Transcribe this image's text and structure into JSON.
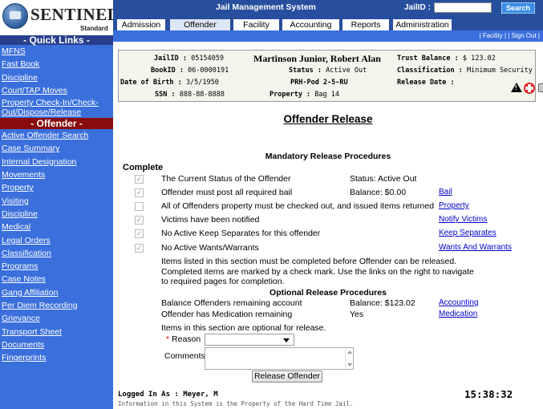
{
  "logo": {
    "brand": "SENTINEL",
    "sub": "Standard"
  },
  "header": {
    "title": "Jail Management System",
    "jailid_label": "JailID :",
    "search_label": "Search",
    "tabs": [
      "Admission",
      "Offender",
      "Facility",
      "Accounting",
      "Reports",
      "Administration"
    ],
    "links": [
      "| Facility |",
      "| Sign Out |"
    ]
  },
  "sidebar": {
    "quick_links_title": "- Quick Links -",
    "quick_links": [
      "MFNS",
      "Fast Book",
      "Discipline",
      "Court/TAP Moves",
      "Property Check-In/Check-Out/Dispose/Release"
    ],
    "offender_title": "- Offender -",
    "offender_links": [
      "Active Offender Search",
      "Case Summary",
      "Internal Designation",
      "Movements",
      "Property",
      "Visiting",
      "Discipline",
      "Medical",
      "Legal Orders",
      "Classification",
      "Programs",
      "Case Notes",
      "Gang Affiliation",
      "Per Diem Recording",
      "Grievance",
      "Transport Sheet",
      "Documents",
      "Fingerprints"
    ]
  },
  "offender": {
    "jailid_label": "JailID :",
    "jailid": "05154059",
    "bookid_label": "BookID :",
    "bookid": "06-0000191",
    "dob_label": "Date of Birth :",
    "dob": "3/5/1950",
    "ssn_label": "SSN :",
    "ssn": "888-88-8888",
    "name": "Martinson Junior, Robert Alan",
    "status_label": "Status :",
    "status": "Active Out",
    "location": "PRH-Pod 2-5-RU",
    "property_label": "Property :",
    "property": "Bag 14",
    "trust_label": "Trust Balance :",
    "trust": "$ 123.02",
    "class_label": "Classification :",
    "classification": "Minimum Security",
    "release_label": "Release Date :",
    "release": ""
  },
  "page_title": "Offender Release",
  "mandatory": {
    "title": "Mandatory Release Procedures",
    "complete_label": "Complete",
    "items": [
      {
        "label": "The Current Status of the Offender",
        "value": "Status: Active Out",
        "link": "",
        "checked": true
      },
      {
        "label": "Offender must post all required bail",
        "value": "Balance: $0.00",
        "link": "Bail",
        "checked": true
      },
      {
        "label": "All of Offenders property must be checked out, and issued items returned",
        "value": "",
        "link": "Property",
        "checked": false
      },
      {
        "label": "Victims have been notified",
        "value": "",
        "link": "Notify Victims",
        "checked": true
      },
      {
        "label": "No Active Keep Separates for this offender",
        "value": "",
        "link": "Keep Separates",
        "checked": true
      },
      {
        "label": "No Active Wants/Warrants",
        "value": "",
        "link": "Wants And Warrants",
        "checked": true
      }
    ],
    "note1": "Items listed in this section must be completed before Offender can be released.",
    "note2": "Completed items are marked by a check mark. Use the links on the right to navigate to required pages for completion."
  },
  "optional": {
    "title": "Optional Release Procedures",
    "items": [
      {
        "label": "Balance Offenders remaining account",
        "value": "Balance: $123.02",
        "link": "Accounting"
      },
      {
        "label": "Offender has Medication remaining",
        "value": "Yes",
        "link": "Medication"
      }
    ],
    "note": "Items in this section are optional for release.",
    "reason_label": "Reason",
    "reason_required": "*",
    "reason_value": "",
    "comments_label": "Comments",
    "comments_value": ""
  },
  "release_button": "Release Offender",
  "footer": {
    "logged_in": "Logged In As : Meyer, M",
    "disclaimer": "Information in this System is the Property of the Hard Time Jail.",
    "time": "15:38:32"
  }
}
